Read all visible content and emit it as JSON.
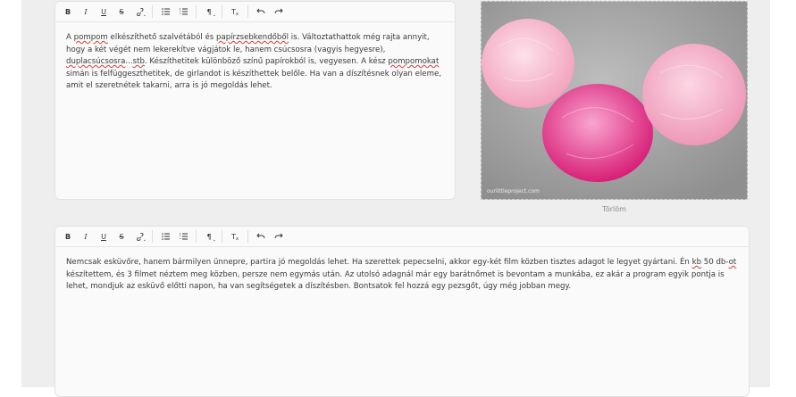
{
  "toolbar": {
    "bold": "B",
    "italic": "I",
    "underline": "U",
    "strike": "S",
    "link_icon": "link-icon",
    "bullet_list_icon": "bullet-list-icon",
    "numbered_list_icon": "numbered-list-icon",
    "paragraph": "¶",
    "clear_format": "T",
    "undo_icon": "undo-icon",
    "redo_icon": "redo-icon"
  },
  "editor1": {
    "segments": [
      {
        "t": "A "
      },
      {
        "t": "pompom",
        "sp": true
      },
      {
        "t": " elkészíthető szalvétából és "
      },
      {
        "t": "papírzsebkendőből",
        "sp": true
      },
      {
        "t": " is. Változtathattok még rajta annyit, hogy a két végét nem lekerekítve vágjátok le, hanem csúcsosra (vagyis hegyesre), "
      },
      {
        "t": "duplacsúcsosra",
        "sp": true
      },
      {
        "t": "..."
      },
      {
        "t": "stb",
        "sp": true
      },
      {
        "t": ". Készíthetitek különböző színű papírokból is, vegyesen. A kész "
      },
      {
        "t": "pompomokat",
        "sp": true
      },
      {
        "t": " simán is felfüggeszthetitek, de girlandot is készíthettek belőle. Ha van a díszítésnek olyan eleme, amit el szeretnétek takarni, arra is jó megoldás lehet."
      }
    ]
  },
  "editor2": {
    "segments": [
      {
        "t": "Nemcsak esküvőre, hanem bármilyen ünnepre, partira jó megoldás lehet. Ha szerettek pepecselni, akkor egy-két film közben tisztes adagot le legyet gyártani. Én "
      },
      {
        "t": "kb",
        "sp": true
      },
      {
        "t": " 50 db-"
      },
      {
        "t": "ot",
        "sp": true
      },
      {
        "t": " készítettem, és 3 filmet néztem meg közben, persze nem egymás után. Az utolsó adagnál már egy barátnőmet is bevontam a munkába, ez akár a program egyik pontja is lehet, mondjuk az esküvő előtti napon, ha van segítségetek a díszítésben. Bontsatok fel hozzá egy pezsgőt, úgy még jobban megy."
      }
    ]
  },
  "image": {
    "watermark": "ourlittleproject.com",
    "colors": {
      "pale_pink": "#f7bcd0",
      "light_pink": "#f3a6c2",
      "hot_pink": "#e8348a",
      "background": "#a9a9a9"
    }
  },
  "delete_label": "Törlöm"
}
